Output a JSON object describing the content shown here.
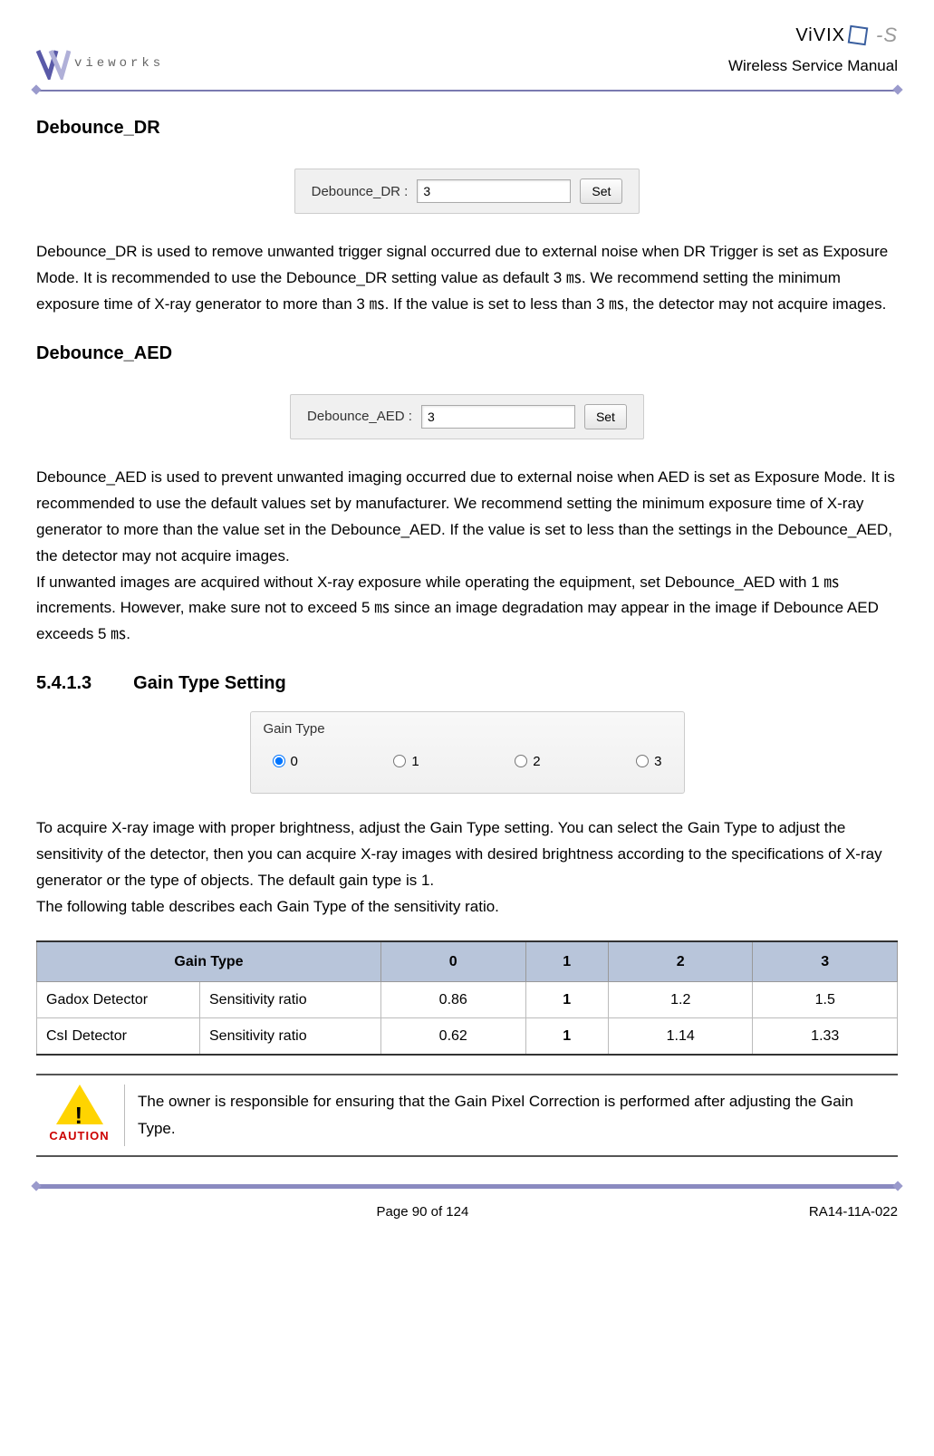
{
  "header": {
    "brand_text": "vieworks",
    "product_logo": "ViVIX",
    "product_suffix": "-S",
    "manual_title": "Wireless Service Manual"
  },
  "section1": {
    "title": "Debounce_DR",
    "ui_label": "Debounce_DR :",
    "ui_value": "3",
    "ui_button": "Set",
    "paragraph": "Debounce_DR is used to remove unwanted trigger signal occurred due to external noise when DR Trigger is set as Exposure Mode. It is recommended to use the Debounce_DR setting value as default 3 ㎳. We recommend setting the minimum exposure time of X-ray generator to more than 3 ㎳. If the value is set to less than 3 ㎳, the detector may not acquire images."
  },
  "section2": {
    "title": "Debounce_AED",
    "ui_label": "Debounce_AED :",
    "ui_value": "3",
    "ui_button": "Set",
    "paragraph": "Debounce_AED is used to prevent unwanted imaging occurred due to external noise when AED is set as Exposure Mode. It is recommended to use the default values set by manufacturer. We recommend setting the minimum exposure time of X-ray generator to more than the value set in the Debounce_AED. If the value is set to less than the settings in the Debounce_AED, the detector may not acquire images.\nIf unwanted images are acquired without X-ray exposure while operating the equipment, set Debounce_AED with 1 ㎳ increments. However, make sure not to exceed 5 ㎳ since an image degradation may appear in the image if Debounce AED exceeds 5 ㎳."
  },
  "section3": {
    "number": "5.4.1.3",
    "title": "Gain Type Setting",
    "widget_title": "Gain Type",
    "options": [
      "0",
      "1",
      "2",
      "3"
    ],
    "selected": "0",
    "paragraph": "To acquire X-ray image with proper brightness, adjust the Gain Type setting. You can select the Gain Type to adjust the sensitivity of the detector, then you can acquire X-ray images with desired brightness according to the specifications of X-ray generator or the type of objects. The default gain type is 1.\nThe following table describes each Gain Type of the sensitivity ratio."
  },
  "table": {
    "header": [
      "Gain Type",
      "0",
      "1",
      "2",
      "3"
    ],
    "rows": [
      {
        "label": "Gadox Detector",
        "sub": "Sensitivity ratio",
        "values": [
          "0.86",
          "1",
          "1.2",
          "1.5"
        ]
      },
      {
        "label": "CsI Detector",
        "sub": "Sensitivity ratio",
        "values": [
          "0.62",
          "1",
          "1.14",
          "1.33"
        ]
      }
    ]
  },
  "caution": {
    "label": "CAUTION",
    "text": "The owner is responsible for ensuring that the Gain Pixel Correction is performed after adjusting the Gain Type."
  },
  "footer": {
    "page": "Page 90 of 124",
    "doc": "RA14-11A-022"
  },
  "chart_data": {
    "type": "table",
    "title": "Gain Type sensitivity ratio",
    "columns": [
      "Gain Type",
      "0",
      "1",
      "2",
      "3"
    ],
    "series": [
      {
        "name": "Gadox Detector – Sensitivity ratio",
        "values": [
          0.86,
          1,
          1.2,
          1.5
        ]
      },
      {
        "name": "CsI Detector – Sensitivity ratio",
        "values": [
          0.62,
          1,
          1.14,
          1.33
        ]
      }
    ]
  }
}
